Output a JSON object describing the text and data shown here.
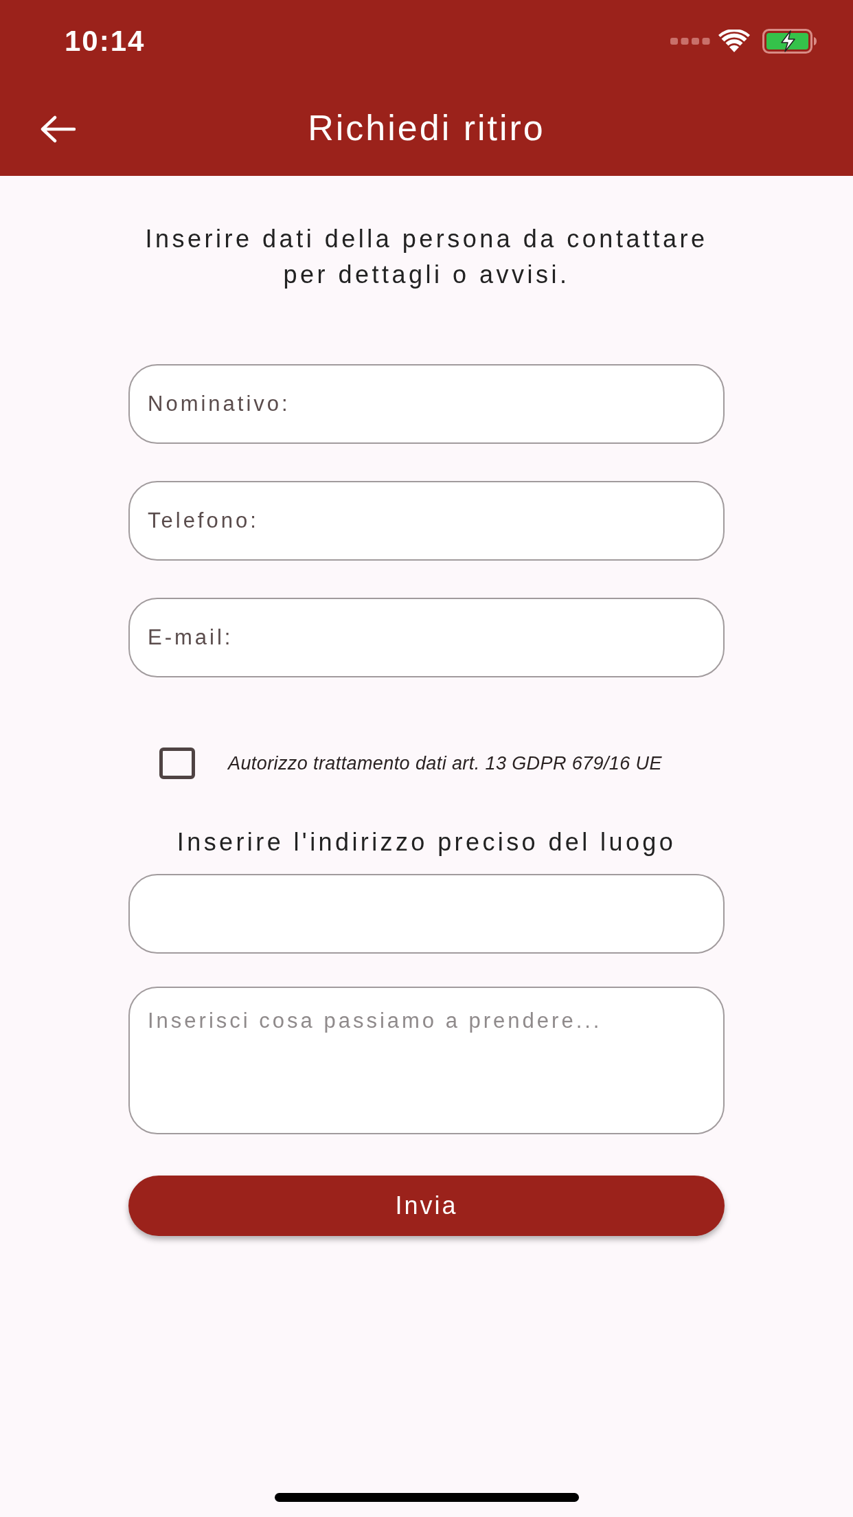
{
  "status_bar": {
    "time": "10:14"
  },
  "app_bar": {
    "title": "Richiedi ritiro"
  },
  "intro": "Inserire dati della persona da contattare per dettagli o avvisi.",
  "contact_fields": [
    {
      "placeholder": "Nominativo:"
    },
    {
      "placeholder": "Telefono:"
    },
    {
      "placeholder": "E-mail:"
    }
  ],
  "consent": {
    "label": "Autorizzo trattamento dati art. 13 GDPR 679/16 UE",
    "checked": false
  },
  "address_heading": "Inserire l'indirizzo preciso del luogo",
  "items_field": {
    "placeholder": "Inserisci cosa passiamo a prendere..."
  },
  "submit_button": "Invia"
}
